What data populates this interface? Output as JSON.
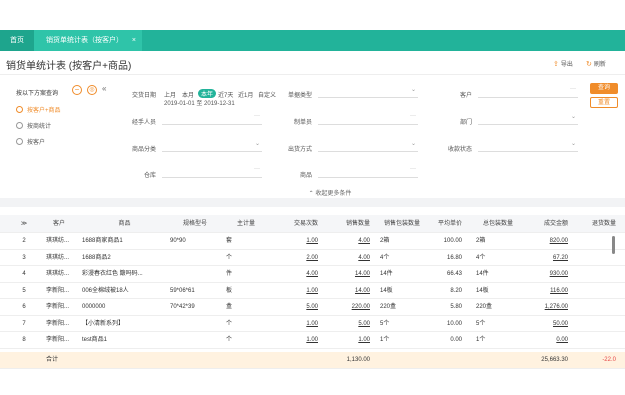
{
  "tabs": {
    "home": "首页",
    "active": "销货单统计表（按客户）",
    "close": "×"
  },
  "header": {
    "title": "销货单统计表 (按客户+商品)",
    "export_label": "导出",
    "refresh_label": "刷新"
  },
  "sidebar": {
    "head": "按以下方案查询",
    "minus": "−",
    "items": [
      {
        "label": "按客户+商品",
        "selected": true
      },
      {
        "label": "按商统计",
        "selected": false
      },
      {
        "label": "按客户",
        "selected": false
      }
    ]
  },
  "filters": {
    "date_label": "交货日期",
    "date_chips": [
      "上月",
      "本月",
      "本年",
      "近7天",
      "近1月",
      "自定义"
    ],
    "date_active": "本年",
    "date_range": "2019-01-01 至 2019-12-31",
    "doc_type_label": "单据类型",
    "customer_label": "客户",
    "salesperson_label": "经手人员",
    "operator_label": "制单员",
    "dept_label": "部门",
    "product_type_label": "商品分类",
    "ship_label": "出货方式",
    "receipt_label": "收款状态",
    "warehouse_label": "仓库",
    "product_label": "商品",
    "collapse_label": "⌃ 收起更多条件"
  },
  "buttons": {
    "query": "查询",
    "reset": "重置"
  },
  "table": {
    "headers": [
      "客户",
      "商品",
      "规格型号",
      "主计量",
      "交易次数",
      "销售数量",
      "销售包装数量",
      "平均单价",
      "总包装数量",
      "成交金额",
      "退货数量"
    ],
    "rows": [
      {
        "idx": "2",
        "cust": "琪琪纺...",
        "prod": "1688商家商品1",
        "spec": "90*90",
        "unit": "套",
        "cnt": "1.00",
        "qty": "4.00",
        "pkg": "2箱",
        "avg": "100.00",
        "tpk": "2箱",
        "amt": "820.00",
        "ret": ""
      },
      {
        "idx": "3",
        "cust": "琪琪纺...",
        "prod": "1688商品2",
        "spec": "",
        "unit": "个",
        "cnt": "2.00",
        "qty": "4.00",
        "pkg": "4个",
        "avg": "16.80",
        "tpk": "4个",
        "amt": "67.20",
        "ret": ""
      },
      {
        "idx": "4",
        "cust": "琪琪纺...",
        "prod": "彩漫春衣红色 簸吗码...",
        "spec": "",
        "unit": "件",
        "cnt": "4.00",
        "qty": "14.00",
        "pkg": "14件",
        "avg": "66.43",
        "tpk": "14件",
        "amt": "930.00",
        "ret": ""
      },
      {
        "idx": "5",
        "cust": "李新阳...",
        "prod": "006全棉绒被18人",
        "spec": "59*06*61",
        "unit": "板",
        "cnt": "1.00",
        "qty": "14.00",
        "pkg": "14板",
        "avg": "8.20",
        "tpk": "14板",
        "amt": "116.00",
        "ret": ""
      },
      {
        "idx": "6",
        "cust": "李新阳...",
        "prod": "0000000",
        "spec": "70*42*39",
        "unit": "盒",
        "cnt": "5.00",
        "qty": "220.00",
        "pkg": "220盒",
        "avg": "5.80",
        "tpk": "220盒",
        "amt": "1,276.00",
        "ret": ""
      },
      {
        "idx": "7",
        "cust": "李新阳...",
        "prod": "【小清新系列】",
        "spec": "",
        "unit": "个",
        "cnt": "1.00",
        "qty": "5.00",
        "pkg": "5个",
        "avg": "10.00",
        "tpk": "5个",
        "amt": "50.00",
        "ret": ""
      },
      {
        "idx": "8",
        "cust": "李新阳...",
        "prod": "test商品1",
        "spec": "",
        "unit": "个",
        "cnt": "1.00",
        "qty": "1.00",
        "pkg": "1个",
        "avg": "0.00",
        "tpk": "1个",
        "amt": "0.00",
        "ret": ""
      }
    ],
    "total": {
      "label": "合计",
      "qty": "1,130.00",
      "amt": "25,663.30",
      "ret": "-22.0"
    }
  }
}
